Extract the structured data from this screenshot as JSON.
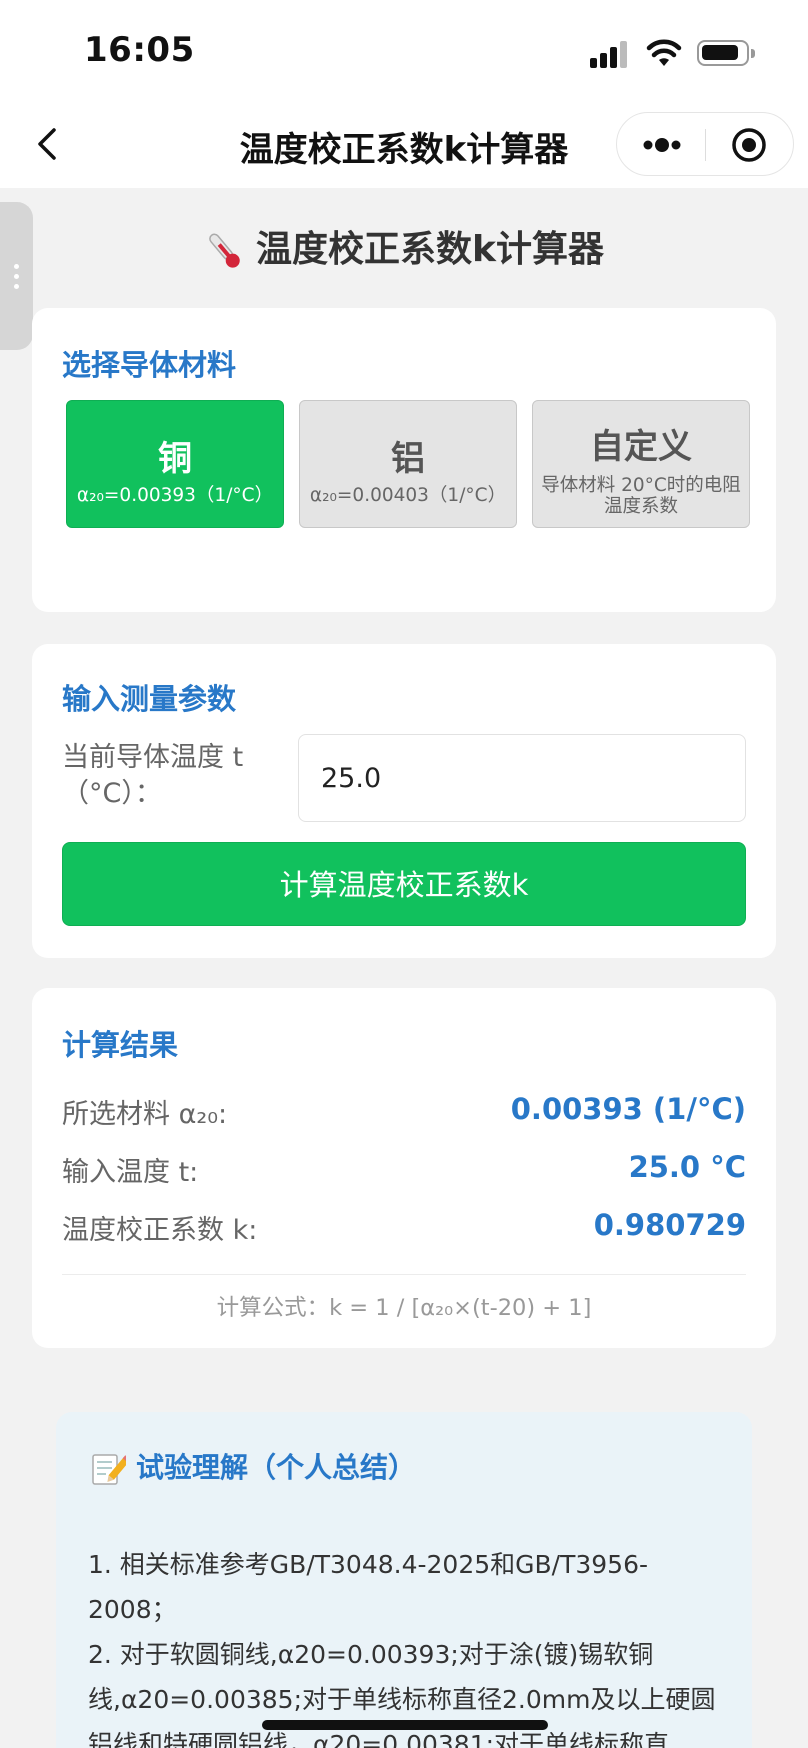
{
  "status_bar": {
    "time": "16:05"
  },
  "nav": {
    "title": "温度校正系数k计算器"
  },
  "page": {
    "title": "温度校正系数k计算器"
  },
  "material_section": {
    "title": "选择导体材料",
    "options": [
      {
        "name": "铜",
        "sub": "α₂₀=0.00393（1/°C）",
        "selected": true
      },
      {
        "name": "铝",
        "sub": "α₂₀=0.00403（1/°C）",
        "selected": false
      },
      {
        "name": "自定义",
        "sub": "导体材料 20°C时的电阻温度系数",
        "selected": false
      }
    ]
  },
  "input_section": {
    "title": "输入测量参数",
    "temp_label": "当前导体温度 t（°C）：",
    "temp_value": "25.0",
    "button_label": "计算温度校正系数k"
  },
  "result_section": {
    "title": "计算结果",
    "rows": [
      {
        "label": "所选材料 α₂₀:",
        "value": "0.00393 (1/°C)"
      },
      {
        "label": "输入温度 t:",
        "value": "25.0 °C"
      },
      {
        "label": "温度校正系数 k:",
        "value": "0.980729"
      }
    ],
    "formula": "计算公式：k = 1 / [α₂₀×(t-20) + 1]"
  },
  "notes": {
    "title": "试验理解（个人总结）",
    "body": "1. 相关标准参考GB/T3048.4-2025和GB/T3956-2008；\n2. 对于软圆铜线,α20=0.00393;对于涂(镀)锡软铜线,α20=0.00385;对于单线标称直径2.0mm及以上硬圆铝线和特硬圆铝线，α20=0.00381;对于单线标称直"
  },
  "colors": {
    "accent_green": "#11c15d",
    "accent_blue": "#2878c8",
    "background": "#f2f2f2"
  }
}
